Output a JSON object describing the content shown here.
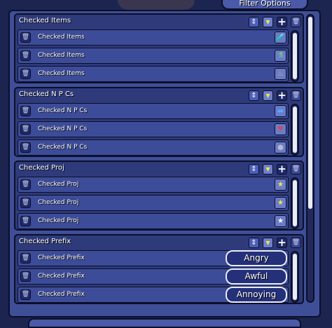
{
  "header": {
    "filter_options_label": "Filter Options"
  },
  "colors": {
    "background": "#1c2550",
    "panel": "#3f4f97",
    "group": "#2e3a7a",
    "entry": "#3d4c98",
    "accent_yellow": "#f5e43a"
  },
  "icons": {
    "sort": "up-down-arrows-icon",
    "filter": "yellow-triangle-dropdown-icon",
    "add": "plus-icon",
    "delete": "trash-can-icon"
  },
  "groups": [
    {
      "title": "Checked Items",
      "entries": [
        {
          "label": "Checked Items",
          "icon_name": "potion-item-icon",
          "glyph": "🧪",
          "color": "#f0a050"
        },
        {
          "label": "Checked Items",
          "icon_name": "green-potion-item-icon",
          "glyph": "⚗",
          "color": "#7bd36b"
        },
        {
          "label": "Checked Items",
          "icon_name": "orange-potion-item-icon",
          "glyph": "♨",
          "color": "#f2b04a"
        }
      ]
    },
    {
      "title": "Checked N P Cs",
      "entries": [
        {
          "label": "Checked N P Cs",
          "icon_name": "blue-slime-npc-icon",
          "glyph": "▬",
          "color": "#5aa8ff"
        },
        {
          "label": "Checked N P Cs",
          "icon_name": "red-creature-npc-icon",
          "glyph": "♥",
          "color": "#d04a5a"
        },
        {
          "label": "Checked N P Cs",
          "icon_name": "gray-slime-npc-icon",
          "glyph": "●",
          "color": "#b8bcc8"
        }
      ]
    },
    {
      "title": "Checked Proj",
      "entries": [
        {
          "label": "Checked Proj",
          "icon_name": "yellow-star-projectile-icon",
          "glyph": "★",
          "color": "#f5e43a"
        },
        {
          "label": "Checked Proj",
          "icon_name": "yellow-star-projectile-icon",
          "glyph": "★",
          "color": "#f5e43a"
        },
        {
          "label": "Checked Proj",
          "icon_name": "white-star-projectile-icon",
          "glyph": "★",
          "color": "#ffffff"
        }
      ]
    },
    {
      "title": "Checked Prefix",
      "entries": [
        {
          "label": "Checked Prefix",
          "value": "Angry"
        },
        {
          "label": "Checked Prefix",
          "value": "Awful"
        },
        {
          "label": "Checked Prefix",
          "value": "Annoying"
        }
      ]
    }
  ]
}
